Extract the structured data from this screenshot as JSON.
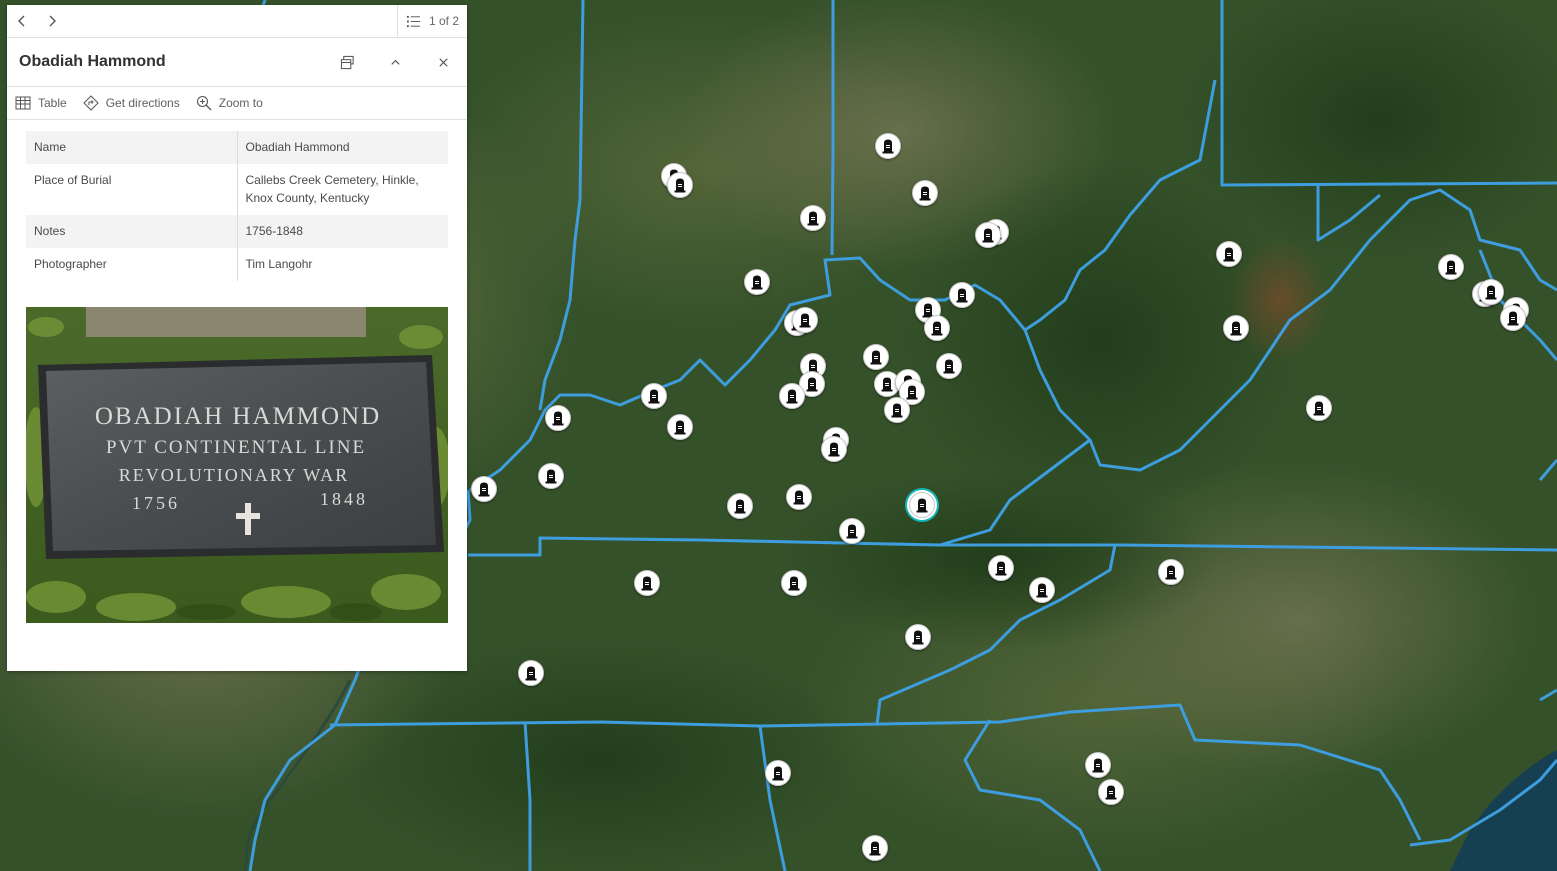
{
  "popup": {
    "count_text": "1 of 2",
    "title": "Obadiah Hammond",
    "actions": {
      "table": "Table",
      "directions": "Get directions",
      "zoom": "Zoom to"
    },
    "attributes": [
      {
        "key": "Name",
        "value": "Obadiah Hammond"
      },
      {
        "key": "Place of Burial",
        "value": "Callebs Creek Cemetery, Hinkle, Knox County, Kentucky"
      },
      {
        "key": "Notes",
        "value": "1756-1848"
      },
      {
        "key": "Photographer",
        "value": "Tim Langohr"
      }
    ],
    "photo": {
      "line1": "OBADIAH  HAMMOND",
      "line2": "PVT  CONTINENTAL  LINE",
      "line3": "REVOLUTIONARY  WAR",
      "year_birth": "1756",
      "year_death": "1848"
    }
  },
  "map": {
    "basemap": "satellite imagery",
    "border_color": "#3d9ddd",
    "marker_icon": "tombstone-icon",
    "selected_color": "#12b6b6"
  }
}
